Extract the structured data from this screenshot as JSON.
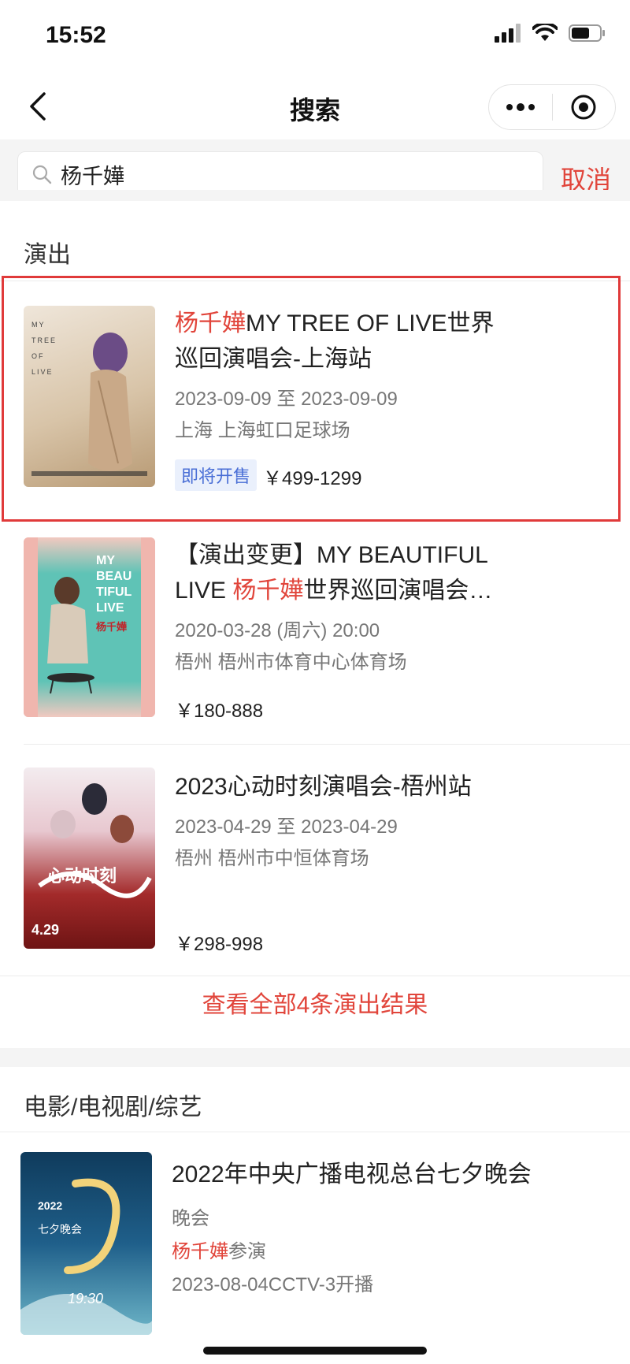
{
  "status": {
    "time": "15:52"
  },
  "nav": {
    "title": "搜索"
  },
  "search": {
    "value": "杨千嬅",
    "cancel_label": "取消"
  },
  "shows": {
    "section_title": "演出",
    "items": [
      {
        "title_highlight": "杨千嬅",
        "title_line1_rest": "MY TREE OF LIVE世界",
        "title_line2": "巡回演唱会-上海站",
        "date": "2023-09-09 至 2023-09-09",
        "venue": "上海 上海虹口足球场",
        "badge": "即将开售",
        "price": "￥499-1299"
      },
      {
        "title_line1": "【演出变更】MY BEAUTIFUL",
        "title_line2_pre": "LIVE ",
        "title_highlight": "杨千嬅",
        "title_line2_rest": "世界巡回演唱会…",
        "date": "2020-03-28 (周六) 20:00",
        "venue": "梧州 梧州市体育中心体育场",
        "price": "￥180-888"
      },
      {
        "title": "2023心动时刻演唱会-梧州站",
        "date": "2023-04-29 至 2023-04-29",
        "venue": "梧州 梧州市中恒体育场",
        "price": "￥298-998"
      }
    ],
    "view_all": "查看全部4条演出结果"
  },
  "media": {
    "section_title": "电影/电视剧/综艺",
    "items": [
      {
        "title": "2022年中央广播电视总台七夕晚会",
        "category": "晚会",
        "cast_highlight": "杨千嬅",
        "cast_suffix": "参演",
        "air": "2023-08-04CCTV-3开播"
      }
    ]
  },
  "posters": {
    "p1": {
      "lines": [
        "MY",
        "TREE",
        "OF",
        "LIVE"
      ],
      "bg": "#d8c4a8"
    },
    "p2": {
      "lines": [
        "MY",
        "BEAU",
        "TIFUL",
        "LIVE"
      ],
      "name": "杨千嬅",
      "bg": "#5fc3b6"
    },
    "p3": {
      "name": "心动时刻",
      "date": "4.29",
      "bg": "#a32a2a"
    },
    "p4": {
      "year": "2022",
      "name": "七夕晚会",
      "time": "19:30",
      "bg": "#1f5f8a"
    }
  },
  "colors": {
    "accent": "#e1453b",
    "badge": "#4a6fd6",
    "frame": "#e03a3a"
  }
}
